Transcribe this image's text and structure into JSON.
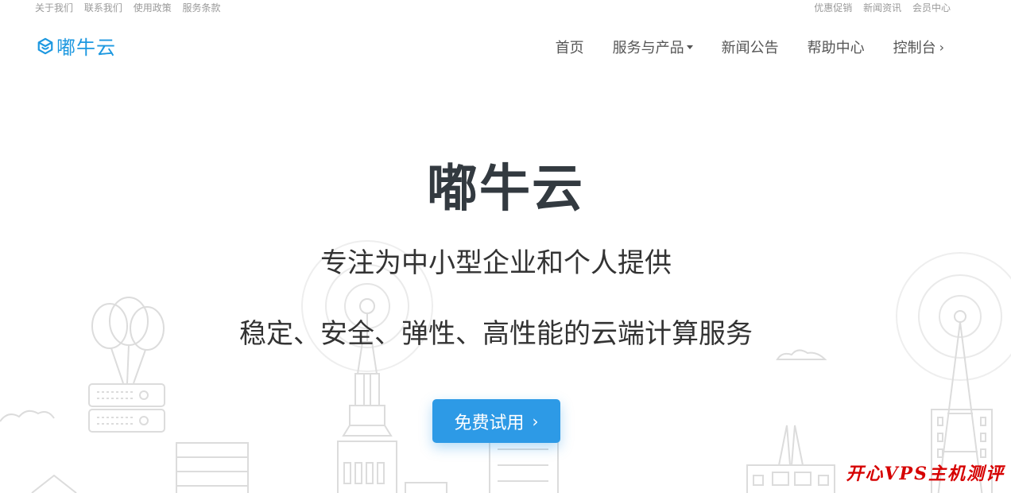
{
  "topbar": {
    "left_links": [
      "关于我们",
      "联系我们",
      "使用政策",
      "服务条款"
    ],
    "right_links": [
      "优惠促销",
      "新闻资讯",
      "会员中心"
    ]
  },
  "nav": {
    "logo_text": "嘟牛云",
    "items": [
      {
        "label": "首页"
      },
      {
        "label": "服务与产品"
      },
      {
        "label": "新闻公告"
      },
      {
        "label": "帮助中心"
      },
      {
        "label": "控制台"
      }
    ]
  },
  "hero": {
    "title": "嘟牛云",
    "subtitle_line1": "专注为中小型企业和个人提供",
    "subtitle_line2": "稳定、安全、弹性、高性能的云端计算服务",
    "cta_label": "免费试用"
  },
  "watermark": "开心VPS主机测评",
  "colors": {
    "brand": "#1d98e0",
    "cta": "#2d9ae6",
    "watermark": "#d60000"
  }
}
